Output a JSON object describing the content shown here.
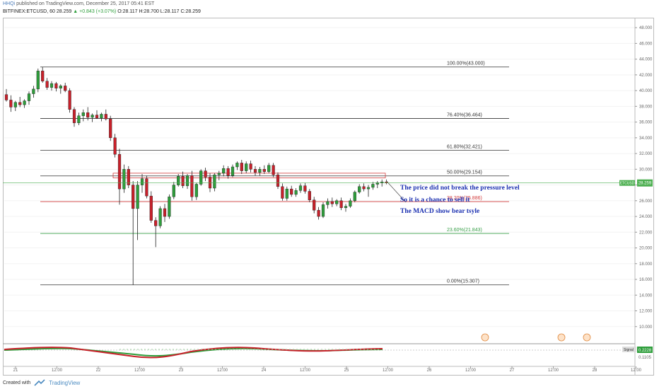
{
  "header": {
    "publisher": "HHQi",
    "published_text": "published on TradingView.com, December 25, 2017 05:41 EST",
    "symbol": "BITFINEX:ETCUSD, 60",
    "last": "28.259",
    "change": "▲ +0.843 (+3.07%)",
    "ohlc": "O:28.117 H:28.700 L:28.117 C:28.259"
  },
  "footer": {
    "created_with": "Created with",
    "brand": "TradingView"
  },
  "colors": {
    "up": "#2e9e3b",
    "down": "#c8202a",
    "fib_black": "#333333",
    "fib_red": "#d23c3c",
    "fib_green": "#3aa04a",
    "note_blue": "#1a2fb0",
    "price_line": "#4caf50"
  },
  "chart_data": {
    "type": "candlestick",
    "y_axis": {
      "min": 8.0,
      "max": 49.0,
      "ticks": [
        "48.000",
        "46.000",
        "44.000",
        "42.000",
        "40.000",
        "38.000",
        "36.000",
        "34.000",
        "32.000",
        "30.000",
        "28.000",
        "26.000",
        "24.000",
        "22.000",
        "20.000",
        "18.000",
        "16.000",
        "14.000",
        "12.000",
        "10.000"
      ]
    },
    "x_axis": {
      "ticks": [
        "21",
        "12:00",
        "22",
        "12:00",
        "23",
        "12:00",
        "24",
        "12:00",
        "25",
        "12:00",
        "26",
        "12:00",
        "27",
        "12:00",
        "28",
        "12:00"
      ]
    },
    "price_tag": {
      "label": "ETCUSD",
      "value": "28.259"
    },
    "fib_levels": [
      {
        "label": "100.00%(43.000)",
        "value": 43.0,
        "color": "black"
      },
      {
        "label": "76.40%(36.464)",
        "value": 36.464,
        "color": "black"
      },
      {
        "label": "61.80%(32.421)",
        "value": 32.421,
        "color": "black"
      },
      {
        "label": "50.00%(29.154)",
        "value": 29.154,
        "color": "black"
      },
      {
        "label": "38.20%(25.886)",
        "value": 25.886,
        "color": "red"
      },
      {
        "label": "23.60%(21.843)",
        "value": 21.843,
        "color": "green"
      },
      {
        "label": "0.00%(15.307)",
        "value": 15.307,
        "color": "black"
      }
    ],
    "resistance_zone": [
      28.9,
      29.5
    ],
    "annotations": [
      "The price did not break the pressure level",
      "So it is a chance to sell it",
      "The MACD show bear tsyle"
    ],
    "candles": [
      [
        39.5,
        40.2,
        38.6,
        38.8
      ],
      [
        38.8,
        39.4,
        37.3,
        37.9
      ],
      [
        37.9,
        38.7,
        37.4,
        38.5
      ],
      [
        38.5,
        39.2,
        37.9,
        38.2
      ],
      [
        38.2,
        38.9,
        37.8,
        38.7
      ],
      [
        38.7,
        39.9,
        38.2,
        39.6
      ],
      [
        39.6,
        40.6,
        39.1,
        40.2
      ],
      [
        40.2,
        42.8,
        39.8,
        42.5
      ],
      [
        42.5,
        43.0,
        41.0,
        41.2
      ],
      [
        41.2,
        41.6,
        40.1,
        40.4
      ],
      [
        40.4,
        41.2,
        40.0,
        40.9
      ],
      [
        40.9,
        41.1,
        39.9,
        40.3
      ],
      [
        40.3,
        40.8,
        39.6,
        40.6
      ],
      [
        40.6,
        41.0,
        39.8,
        40.0
      ],
      [
        40.0,
        40.3,
        37.2,
        37.6
      ],
      [
        37.6,
        37.9,
        35.4,
        35.9
      ],
      [
        35.9,
        37.2,
        35.6,
        36.8
      ],
      [
        36.8,
        37.6,
        36.1,
        37.2
      ],
      [
        37.2,
        37.9,
        36.2,
        36.6
      ],
      [
        36.6,
        37.1,
        36.0,
        36.9
      ],
      [
        36.9,
        37.5,
        36.4,
        36.5
      ],
      [
        36.5,
        37.2,
        36.1,
        37.0
      ],
      [
        37.0,
        37.6,
        36.2,
        36.4
      ],
      [
        36.4,
        36.8,
        33.6,
        34.0
      ],
      [
        34.0,
        34.5,
        31.5,
        31.9
      ],
      [
        31.9,
        32.6,
        25.5,
        27.5
      ],
      [
        27.5,
        30.6,
        27.0,
        30.0
      ],
      [
        30.0,
        30.4,
        27.6,
        28.0
      ],
      [
        28.0,
        28.5,
        15.3,
        25.0
      ],
      [
        25.0,
        28.5,
        21.0,
        28.0
      ],
      [
        28.0,
        29.4,
        27.0,
        28.8
      ],
      [
        28.8,
        29.2,
        26.3,
        26.6
      ],
      [
        26.6,
        27.2,
        23.2,
        23.5
      ],
      [
        23.5,
        23.9,
        20.1,
        22.8
      ],
      [
        22.8,
        25.3,
        22.5,
        25.0
      ],
      [
        25.0,
        25.6,
        23.3,
        24.0
      ],
      [
        24.0,
        26.8,
        23.7,
        26.5
      ],
      [
        26.5,
        28.4,
        26.2,
        28.0
      ],
      [
        28.0,
        29.4,
        27.8,
        29.1
      ],
      [
        29.1,
        29.7,
        27.6,
        27.9
      ],
      [
        27.9,
        29.4,
        27.5,
        29.2
      ],
      [
        29.2,
        29.8,
        26.0,
        26.5
      ],
      [
        26.5,
        28.3,
        26.1,
        28.1
      ],
      [
        28.1,
        30.0,
        27.9,
        29.8
      ],
      [
        29.8,
        30.2,
        28.5,
        29.0
      ],
      [
        29.0,
        29.5,
        27.1,
        27.6
      ],
      [
        27.6,
        29.5,
        27.2,
        29.3
      ],
      [
        29.3,
        29.8,
        28.6,
        29.5
      ],
      [
        29.5,
        30.5,
        29.1,
        30.1
      ],
      [
        30.1,
        30.4,
        28.8,
        29.2
      ],
      [
        29.2,
        30.6,
        29.0,
        30.3
      ],
      [
        30.3,
        31.0,
        29.9,
        30.8
      ],
      [
        30.8,
        31.2,
        29.4,
        29.8
      ],
      [
        29.8,
        31.0,
        29.5,
        30.7
      ],
      [
        30.7,
        31.1,
        29.6,
        30.0
      ],
      [
        30.0,
        30.4,
        29.2,
        29.6
      ],
      [
        29.6,
        30.3,
        29.2,
        30.0
      ],
      [
        30.0,
        30.5,
        29.4,
        29.7
      ],
      [
        29.7,
        30.8,
        29.5,
        30.5
      ],
      [
        30.5,
        30.8,
        29.0,
        29.3
      ],
      [
        29.3,
        29.6,
        27.5,
        27.8
      ],
      [
        27.8,
        28.2,
        26.0,
        26.3
      ],
      [
        26.3,
        27.8,
        26.0,
        27.5
      ],
      [
        27.5,
        27.9,
        26.5,
        26.8
      ],
      [
        26.8,
        27.6,
        26.5,
        27.3
      ],
      [
        27.3,
        28.2,
        27.0,
        27.9
      ],
      [
        27.9,
        28.3,
        26.9,
        27.2
      ],
      [
        27.2,
        27.5,
        25.8,
        26.1
      ],
      [
        26.1,
        26.5,
        24.4,
        24.8
      ],
      [
        24.8,
        25.2,
        23.6,
        24.0
      ],
      [
        24.0,
        25.8,
        23.8,
        25.5
      ],
      [
        25.5,
        26.3,
        25.0,
        25.9
      ],
      [
        25.9,
        26.4,
        25.2,
        25.6
      ],
      [
        25.6,
        26.2,
        25.3,
        26.0
      ],
      [
        26.0,
        26.4,
        24.8,
        25.1
      ],
      [
        25.1,
        25.6,
        24.6,
        25.3
      ],
      [
        25.3,
        26.3,
        25.1,
        26.0
      ],
      [
        26.0,
        27.3,
        25.8,
        27.1
      ],
      [
        27.1,
        28.1,
        26.9,
        27.8
      ],
      [
        27.8,
        28.2,
        27.2,
        27.5
      ],
      [
        27.5,
        28.0,
        26.5,
        27.7
      ],
      [
        27.7,
        28.4,
        27.4,
        28.1
      ],
      [
        28.1,
        28.5,
        27.6,
        28.3
      ],
      [
        28.3,
        28.7,
        27.8,
        28.4
      ],
      [
        28.4,
        28.7,
        28.1,
        28.259
      ]
    ],
    "macd": {
      "label": "Signal",
      "values": [
        "0.2228",
        "0.1105"
      ]
    }
  }
}
